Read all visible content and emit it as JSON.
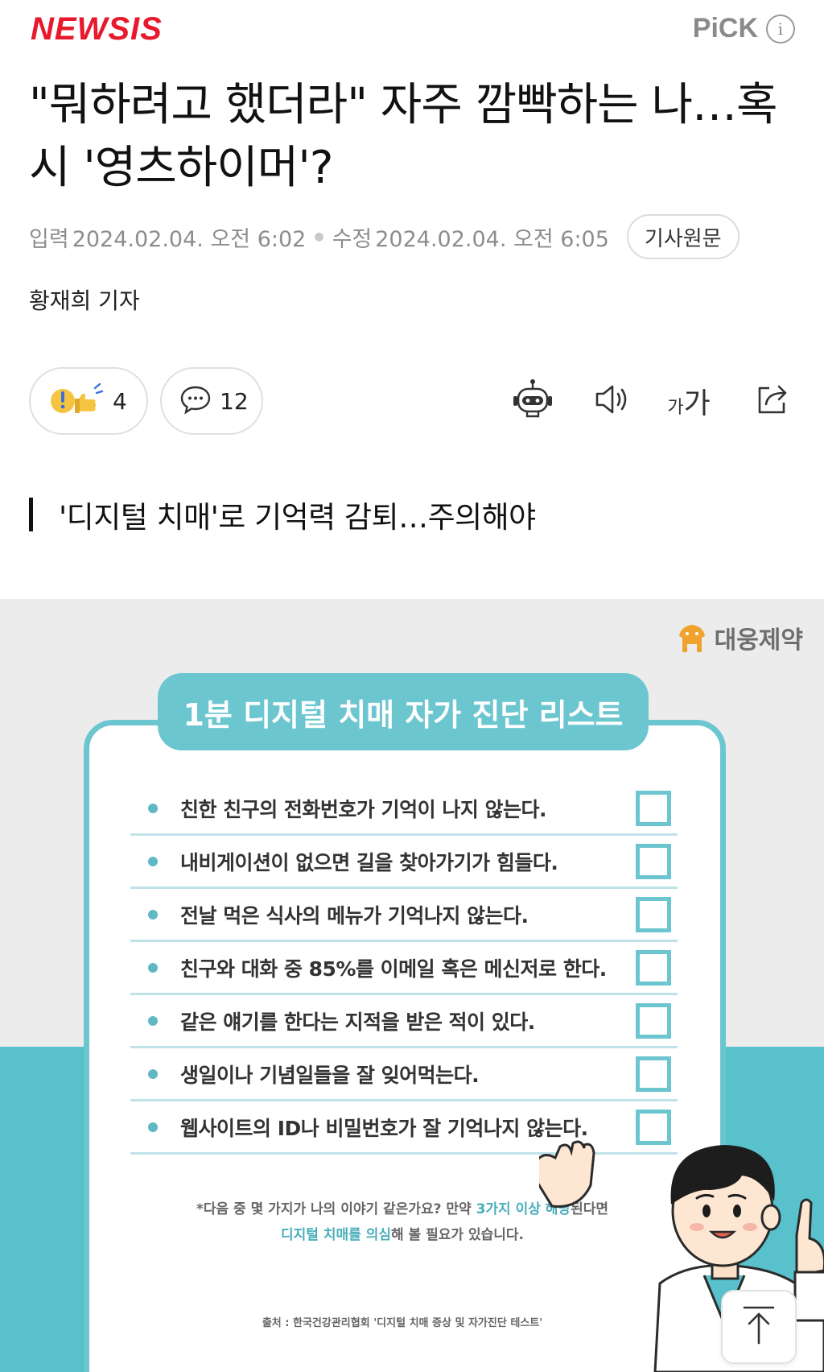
{
  "header": {
    "logo_text": "NEWSIS",
    "pick_label": "PiCK",
    "info_icon": "i"
  },
  "article": {
    "headline": "\"뭐하려고 했더라\" 자주 깜빡하는 나…혹시 '영츠하이머'?",
    "meta": {
      "input_label": "입력",
      "input_date": "2024.02.04. 오전 6:02",
      "edit_label": "수정",
      "edit_date": "2024.02.04. 오전 6:05",
      "original_button": "기사원문"
    },
    "author": "황재희 기자",
    "reactions": {
      "count": "4",
      "comments": "12"
    },
    "tools": [
      "robot-icon",
      "speaker-icon",
      "font-size-icon",
      "share-icon"
    ],
    "font_size_small": "가",
    "font_size_large": "가",
    "subheading": "'디지털 치매'로 기억력 감퇴…주의해야"
  },
  "figure": {
    "brand": "대웅제약",
    "title": "1분 디지털 치매 자가 진단 리스트",
    "checklist": [
      "친한 친구의 전화번호가 기억이 나지 않는다.",
      "내비게이션이 없으면 길을 찾아가기가 힘들다.",
      "전날 먹은 식사의 메뉴가 기억나지 않는다.",
      "친구와 대화 중 85%를 이메일 혹은 메신저로 한다.",
      "같은 얘기를 한다는 지적을 받은 적이 있다.",
      "생일이나 기념일들을 잘 잊어먹는다.",
      "웹사이트의 ID나 비밀번호가 잘 기억나지 않는다."
    ],
    "note_line1_pre": "*다음 중 몇 가지가 나의 이야기 같은가요? 만약 ",
    "note_line1_hl": "3가지 이상 해당",
    "note_line1_post": "된다면",
    "note_line2_hl": "디지털 치매를 의심",
    "note_line2_post": "해 볼 필요가 있습니다.",
    "source": "출처 : 한국건강관리협회 '디지털 치매 증상 및 자가진단 테스트'"
  },
  "colors": {
    "brand_red": "#e8192c",
    "teal": "#6cc6d0",
    "teal_dark": "#4aaebb",
    "figure_bg": "#ececec",
    "figure_bottom": "#59c1cc"
  }
}
